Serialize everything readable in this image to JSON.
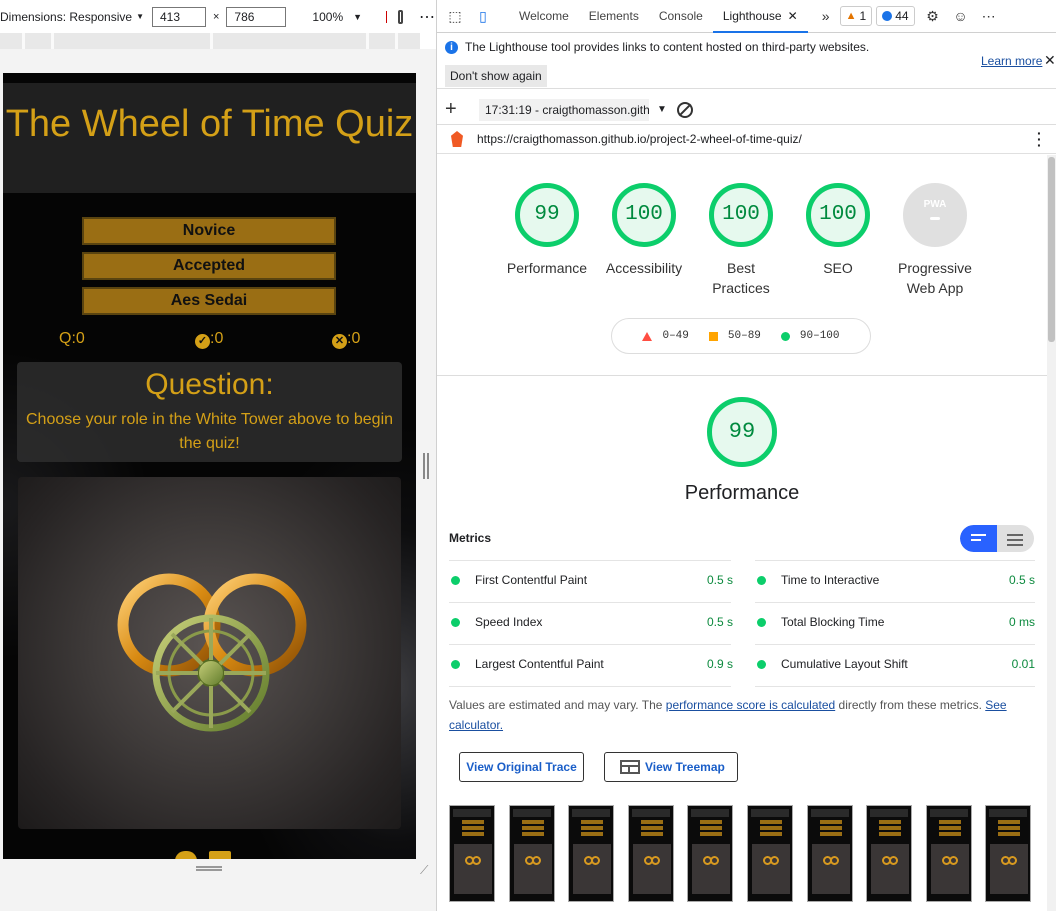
{
  "device_toolbar": {
    "dimensions_label": "Dimensions: Responsive",
    "width_value": "413",
    "times": "×",
    "height_value": "786",
    "zoom": "100%"
  },
  "quiz": {
    "title": "The Wheel of Time Quiz",
    "difficulty_buttons": [
      "Novice",
      "Accepted",
      "Aes Sedai"
    ],
    "score_questions": "Q:0",
    "score_correct": ":0",
    "score_incorrect": ":0",
    "question_heading": "Question:",
    "question_text": "Choose your role in the White Tower above to begin the quiz!",
    "colors": {
      "gold": "#d4a017",
      "button": "#9a6e14"
    }
  },
  "devtools": {
    "tabs": [
      "Welcome",
      "Elements",
      "Console",
      "Lighthouse"
    ],
    "active_tab": "Lighthouse",
    "warnings_count": "1",
    "messages_count": "44",
    "infobar": {
      "text": "The Lighthouse tool provides links to content hosted on third-party websites.",
      "dont_show": "Don't show again",
      "learn_more": "Learn more"
    },
    "report_select": "17:31:19 - craigthomasson.gith",
    "report_url": "https://craigthomasson.github.io/project-2-wheel-of-time-quiz/"
  },
  "lighthouse": {
    "gauges": [
      {
        "label": "Performance",
        "score": "99"
      },
      {
        "label": "Accessibility",
        "score": "100"
      },
      {
        "label": "Best Practices",
        "score": "100"
      },
      {
        "label": "SEO",
        "score": "100"
      },
      {
        "label": "Progressive Web App",
        "score": "PWA"
      }
    ],
    "legend": [
      "0–49",
      "50–89",
      "90–100"
    ],
    "performance_score": "99",
    "performance_label": "Performance",
    "metrics_title": "Metrics",
    "metrics": [
      {
        "name": "First Contentful Paint",
        "value": "0.5 s"
      },
      {
        "name": "Time to Interactive",
        "value": "0.5 s"
      },
      {
        "name": "Speed Index",
        "value": "0.5 s"
      },
      {
        "name": "Total Blocking Time",
        "value": "0 ms"
      },
      {
        "name": "Largest Contentful Paint",
        "value": "0.9 s"
      },
      {
        "name": "Cumulative Layout Shift",
        "value": "0.01"
      }
    ],
    "note_prefix": "Values are estimated and may vary. The ",
    "note_link": "performance score is calculated",
    "note_middle": " directly from these metrics. ",
    "note_link2": "See calculator.",
    "view_trace": "View Original Trace",
    "view_treemap": "View Treemap",
    "colors": {
      "pass": "#0cce6b",
      "average": "#ffa400",
      "fail": "#ff4e42"
    }
  }
}
